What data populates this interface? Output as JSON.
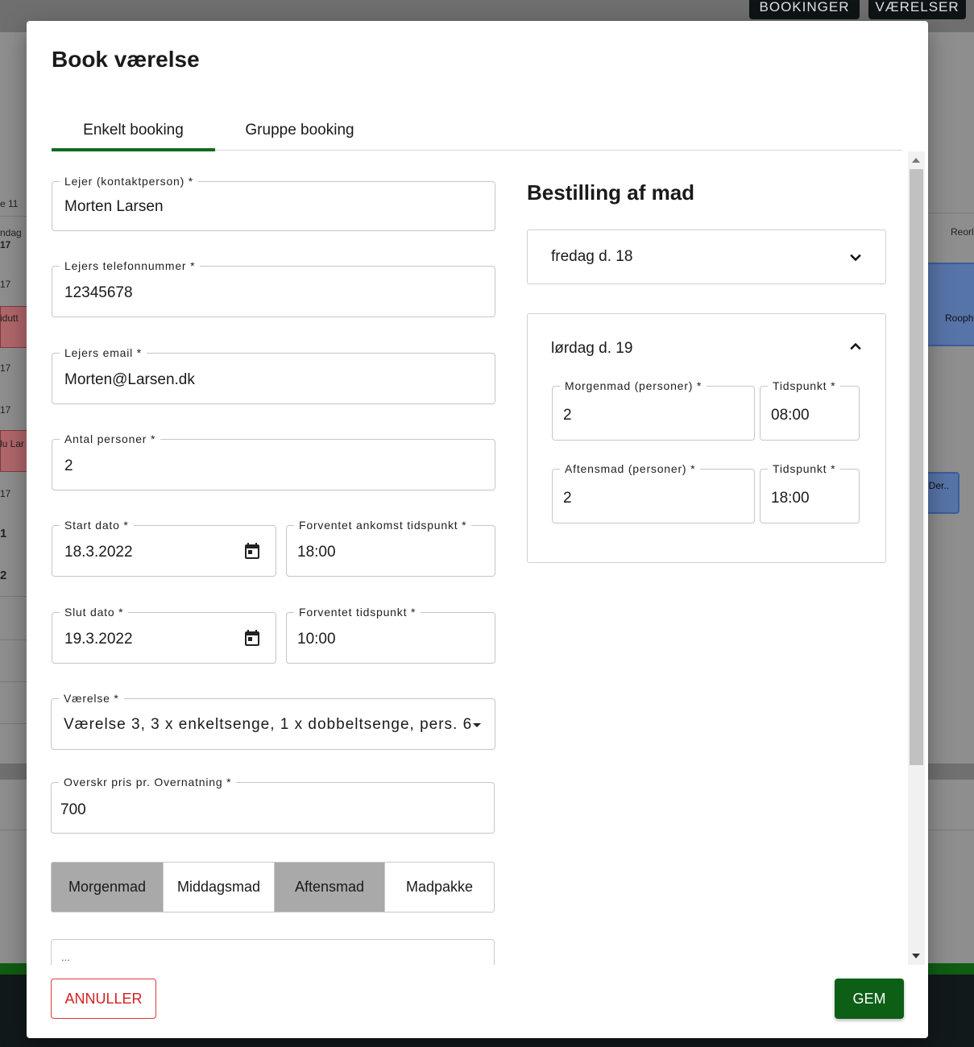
{
  "background": {
    "top_buttons": [
      "BOOKINGER",
      "VÆRELSER"
    ],
    "left_fragments": [
      "e 11",
      "ndag",
      "17",
      "17",
      "idutt",
      "17",
      "17",
      "lu Lar",
      "17",
      "1",
      "2"
    ],
    "right_fragments": [
      "Reorl",
      "Roophi",
      "lDer.."
    ]
  },
  "dialog": {
    "title": "Book værelse",
    "tabs": [
      {
        "label": "Enkelt booking",
        "active": true
      },
      {
        "label": "Gruppe booking",
        "active": false
      }
    ],
    "form": {
      "tenant": {
        "label": "Lejer (kontaktperson) *",
        "value": "Morten Larsen"
      },
      "phone": {
        "label": "Lejers telefonnummer *",
        "value": "12345678"
      },
      "email": {
        "label": "Lejers email *",
        "value": "Morten@Larsen.dk"
      },
      "persons": {
        "label": "Antal personer *",
        "value": "2"
      },
      "start_date": {
        "label": "Start dato *",
        "value": "18.3.2022"
      },
      "arrival_time": {
        "label": "Forventet ankomst tidspunkt *",
        "value": "18:00"
      },
      "end_date": {
        "label": "Slut dato *",
        "value": "19.3.2022"
      },
      "departure_time": {
        "label": "Forventet tidspunkt *",
        "value": "10:00"
      },
      "room": {
        "label": "Værelse *",
        "value": "Værelse 3, 3 x enkeltsenge, 1 x dobbeltsenge, pers. 6"
      },
      "price": {
        "label": "Overskr pris pr. Overnatning *",
        "value": "700"
      },
      "meals": [
        {
          "label": "Morgenmad",
          "selected": true
        },
        {
          "label": "Middagsmad",
          "selected": false
        },
        {
          "label": "Aftensmad",
          "selected": true
        },
        {
          "label": "Madpakke",
          "selected": false
        }
      ],
      "notes_placeholder": "..."
    },
    "food": {
      "title": "Bestilling af mad",
      "days": [
        {
          "label": "fredag d. 18",
          "expanded": false
        },
        {
          "label": "lørdag d. 19",
          "expanded": true,
          "breakfast": {
            "label": "Morgenmad (personer) *",
            "value": "2",
            "time_label": "Tidspunkt *",
            "time": "08:00"
          },
          "dinner": {
            "label": "Aftensmad (personer) *",
            "value": "2",
            "time_label": "Tidspunkt *",
            "time": "18:00"
          }
        }
      ]
    },
    "actions": {
      "cancel": "ANNULLER",
      "save": "GEM"
    },
    "colors": {
      "accent": "#0f6b1e",
      "save": "#0d5f16",
      "cancel": "#d32020"
    }
  }
}
